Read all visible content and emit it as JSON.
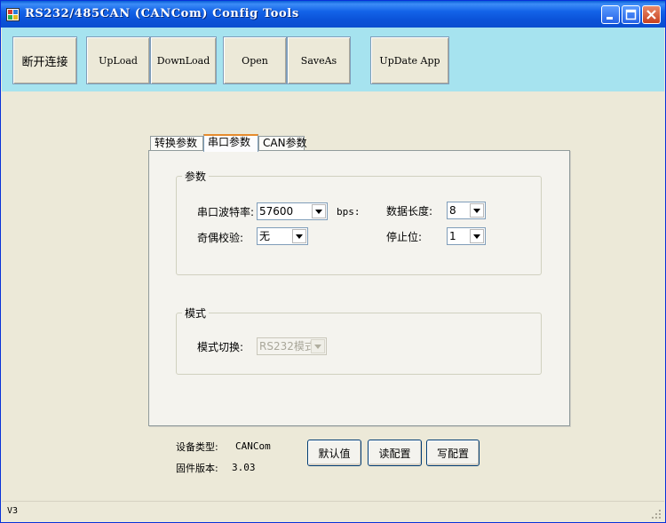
{
  "window": {
    "title": "RS232/485CAN (CANCom)  Config Tools",
    "icon": "app-grid-icon",
    "controls": [
      "minimize-icon",
      "maximize-icon",
      "close-icon"
    ]
  },
  "toolbar": {
    "disconnect_label": "断开连接",
    "upload_label": "UpLoad",
    "download_label": "DownLoad",
    "open_label": "Open",
    "saveas_label": "SaveAs",
    "update_label": "UpDate App"
  },
  "tabs": [
    {
      "label": "转换参数",
      "active": false
    },
    {
      "label": "串口参数",
      "active": true
    },
    {
      "label": "CAN参数",
      "active": false
    }
  ],
  "params_group": {
    "title": "参数",
    "baud_label": "串口波特率:",
    "baud_value": "57600",
    "baud_unit": "bps:",
    "parity_label": "奇偶校验:",
    "parity_value": "无",
    "databits_label": "数据长度:",
    "databits_value": "8",
    "stopbits_label": "停止位:",
    "stopbits_value": "1"
  },
  "mode_group": {
    "title": "模式",
    "mode_label": "模式切换:",
    "mode_value": "RS232模式"
  },
  "device_info": {
    "type_label": "设备类型:",
    "type_value": "CANCom",
    "fw_label": "固件版本:",
    "fw_value": "3.03"
  },
  "actions": {
    "default_label": "默认值",
    "read_label": "读配置",
    "write_label": "写配置"
  },
  "status": {
    "text": "V3"
  },
  "colors": {
    "titlebar": "#0b53d9",
    "toolbar_bg": "#a6e3ef",
    "window_bg": "#ece9d8",
    "active_tab_accent": "#e68b2c"
  }
}
